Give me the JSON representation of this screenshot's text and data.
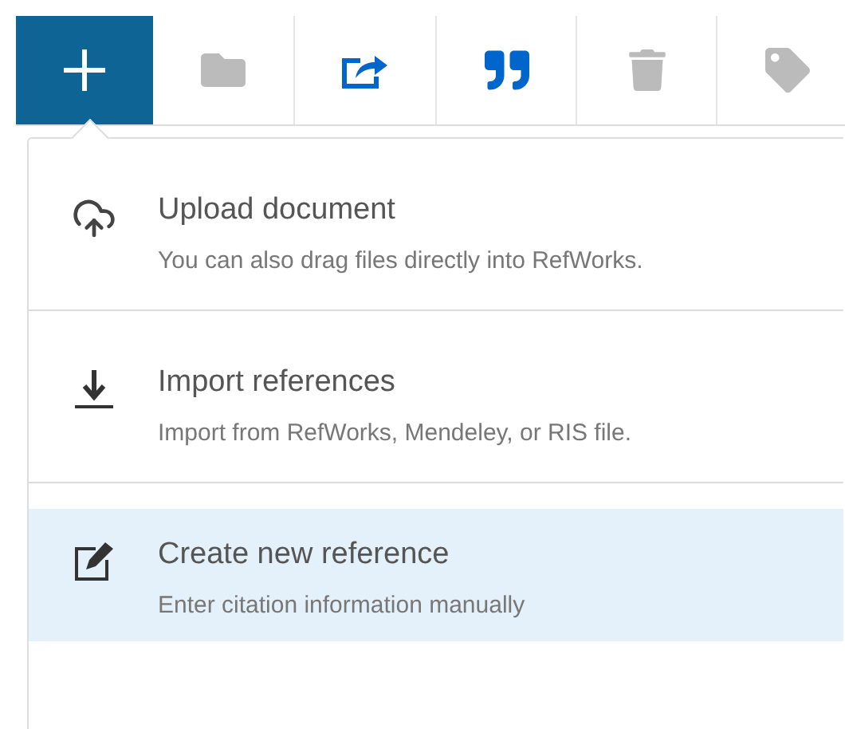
{
  "toolbar": [
    {
      "kind": "add",
      "selected": true,
      "disabled": false
    },
    {
      "kind": "folder",
      "selected": false,
      "disabled": true
    },
    {
      "kind": "share",
      "selected": false,
      "disabled": false
    },
    {
      "kind": "quote",
      "selected": false,
      "disabled": false
    },
    {
      "kind": "trash",
      "selected": false,
      "disabled": true
    },
    {
      "kind": "tag",
      "selected": false,
      "disabled": true
    }
  ],
  "menu": [
    {
      "kind": "upload",
      "title": "Upload document",
      "description": "You can also drag files directly into RefWorks.",
      "selected": false
    },
    {
      "kind": "import",
      "title": "Import references",
      "description": "Import from RefWorks, Mendeley, or RIS file.",
      "selected": false
    },
    {
      "kind": "create",
      "title": "Create new reference",
      "description": "Enter citation information manually",
      "selected": true
    }
  ]
}
